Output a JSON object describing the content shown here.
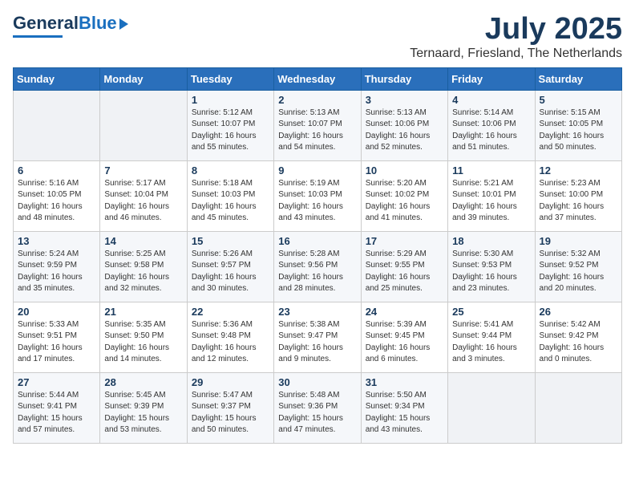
{
  "logo": {
    "text1": "General",
    "text2": "Blue"
  },
  "title": "July 2025",
  "subtitle": "Ternaard, Friesland, The Netherlands",
  "weekdays": [
    "Sunday",
    "Monday",
    "Tuesday",
    "Wednesday",
    "Thursday",
    "Friday",
    "Saturday"
  ],
  "weeks": [
    [
      {
        "day": "",
        "detail": ""
      },
      {
        "day": "",
        "detail": ""
      },
      {
        "day": "1",
        "detail": "Sunrise: 5:12 AM\nSunset: 10:07 PM\nDaylight: 16 hours\nand 55 minutes."
      },
      {
        "day": "2",
        "detail": "Sunrise: 5:13 AM\nSunset: 10:07 PM\nDaylight: 16 hours\nand 54 minutes."
      },
      {
        "day": "3",
        "detail": "Sunrise: 5:13 AM\nSunset: 10:06 PM\nDaylight: 16 hours\nand 52 minutes."
      },
      {
        "day": "4",
        "detail": "Sunrise: 5:14 AM\nSunset: 10:06 PM\nDaylight: 16 hours\nand 51 minutes."
      },
      {
        "day": "5",
        "detail": "Sunrise: 5:15 AM\nSunset: 10:05 PM\nDaylight: 16 hours\nand 50 minutes."
      }
    ],
    [
      {
        "day": "6",
        "detail": "Sunrise: 5:16 AM\nSunset: 10:05 PM\nDaylight: 16 hours\nand 48 minutes."
      },
      {
        "day": "7",
        "detail": "Sunrise: 5:17 AM\nSunset: 10:04 PM\nDaylight: 16 hours\nand 46 minutes."
      },
      {
        "day": "8",
        "detail": "Sunrise: 5:18 AM\nSunset: 10:03 PM\nDaylight: 16 hours\nand 45 minutes."
      },
      {
        "day": "9",
        "detail": "Sunrise: 5:19 AM\nSunset: 10:03 PM\nDaylight: 16 hours\nand 43 minutes."
      },
      {
        "day": "10",
        "detail": "Sunrise: 5:20 AM\nSunset: 10:02 PM\nDaylight: 16 hours\nand 41 minutes."
      },
      {
        "day": "11",
        "detail": "Sunrise: 5:21 AM\nSunset: 10:01 PM\nDaylight: 16 hours\nand 39 minutes."
      },
      {
        "day": "12",
        "detail": "Sunrise: 5:23 AM\nSunset: 10:00 PM\nDaylight: 16 hours\nand 37 minutes."
      }
    ],
    [
      {
        "day": "13",
        "detail": "Sunrise: 5:24 AM\nSunset: 9:59 PM\nDaylight: 16 hours\nand 35 minutes."
      },
      {
        "day": "14",
        "detail": "Sunrise: 5:25 AM\nSunset: 9:58 PM\nDaylight: 16 hours\nand 32 minutes."
      },
      {
        "day": "15",
        "detail": "Sunrise: 5:26 AM\nSunset: 9:57 PM\nDaylight: 16 hours\nand 30 minutes."
      },
      {
        "day": "16",
        "detail": "Sunrise: 5:28 AM\nSunset: 9:56 PM\nDaylight: 16 hours\nand 28 minutes."
      },
      {
        "day": "17",
        "detail": "Sunrise: 5:29 AM\nSunset: 9:55 PM\nDaylight: 16 hours\nand 25 minutes."
      },
      {
        "day": "18",
        "detail": "Sunrise: 5:30 AM\nSunset: 9:53 PM\nDaylight: 16 hours\nand 23 minutes."
      },
      {
        "day": "19",
        "detail": "Sunrise: 5:32 AM\nSunset: 9:52 PM\nDaylight: 16 hours\nand 20 minutes."
      }
    ],
    [
      {
        "day": "20",
        "detail": "Sunrise: 5:33 AM\nSunset: 9:51 PM\nDaylight: 16 hours\nand 17 minutes."
      },
      {
        "day": "21",
        "detail": "Sunrise: 5:35 AM\nSunset: 9:50 PM\nDaylight: 16 hours\nand 14 minutes."
      },
      {
        "day": "22",
        "detail": "Sunrise: 5:36 AM\nSunset: 9:48 PM\nDaylight: 16 hours\nand 12 minutes."
      },
      {
        "day": "23",
        "detail": "Sunrise: 5:38 AM\nSunset: 9:47 PM\nDaylight: 16 hours\nand 9 minutes."
      },
      {
        "day": "24",
        "detail": "Sunrise: 5:39 AM\nSunset: 9:45 PM\nDaylight: 16 hours\nand 6 minutes."
      },
      {
        "day": "25",
        "detail": "Sunrise: 5:41 AM\nSunset: 9:44 PM\nDaylight: 16 hours\nand 3 minutes."
      },
      {
        "day": "26",
        "detail": "Sunrise: 5:42 AM\nSunset: 9:42 PM\nDaylight: 16 hours\nand 0 minutes."
      }
    ],
    [
      {
        "day": "27",
        "detail": "Sunrise: 5:44 AM\nSunset: 9:41 PM\nDaylight: 15 hours\nand 57 minutes."
      },
      {
        "day": "28",
        "detail": "Sunrise: 5:45 AM\nSunset: 9:39 PM\nDaylight: 15 hours\nand 53 minutes."
      },
      {
        "day": "29",
        "detail": "Sunrise: 5:47 AM\nSunset: 9:37 PM\nDaylight: 15 hours\nand 50 minutes."
      },
      {
        "day": "30",
        "detail": "Sunrise: 5:48 AM\nSunset: 9:36 PM\nDaylight: 15 hours\nand 47 minutes."
      },
      {
        "day": "31",
        "detail": "Sunrise: 5:50 AM\nSunset: 9:34 PM\nDaylight: 15 hours\nand 43 minutes."
      },
      {
        "day": "",
        "detail": ""
      },
      {
        "day": "",
        "detail": ""
      }
    ]
  ]
}
